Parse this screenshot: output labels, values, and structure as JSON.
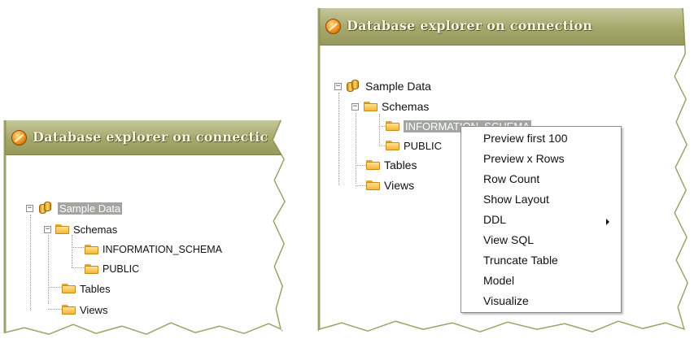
{
  "left_panel": {
    "title": "Database explorer on connectic",
    "tree": {
      "root": "Sample Data",
      "schemas": "Schemas",
      "information_schema": "INFORMATION_SCHEMA",
      "public": "PUBLIC",
      "tables": "Tables",
      "views": "Views"
    }
  },
  "right_panel": {
    "title": "Database explorer on connection",
    "tree": {
      "root": "Sample Data",
      "schemas": "Schemas",
      "information_schema": "INFORMATION_SCHEMA",
      "public": "PUBLIC",
      "tables": "Tables",
      "views": "Views"
    },
    "context_menu": {
      "items": [
        "Preview first 100",
        "Preview x Rows",
        "Row Count",
        "Show Layout",
        "DDL",
        "View SQL",
        "Truncate Table",
        "Model",
        "Visualize"
      ]
    }
  },
  "colors": {
    "titlebar": "#a5a86c",
    "title_text": "#f7f4df",
    "selection": "#a3a5a0",
    "torn_edge_shadow": "#8f9050"
  },
  "icons": {
    "title": "connection-icon",
    "database": "database-icon",
    "folder": "folder-icon",
    "expander": "expander-icon",
    "submenu": "submenu-arrow-icon"
  }
}
